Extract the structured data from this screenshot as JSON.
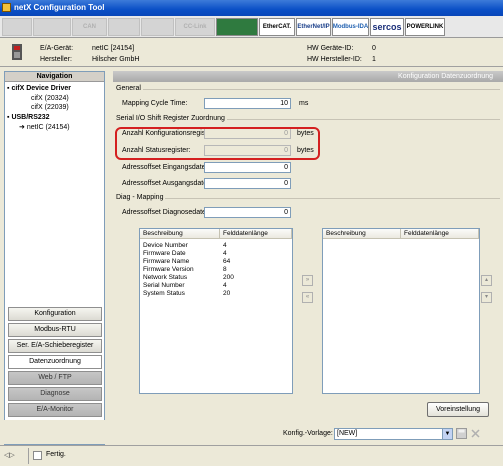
{
  "window": {
    "title": "netX Configuration Tool"
  },
  "logos": [
    {
      "name": "logo-1",
      "text": "",
      "dim": true
    },
    {
      "name": "logo-2",
      "text": "",
      "dim": true
    },
    {
      "name": "logo-canopen",
      "text": "CAN",
      "dim": true
    },
    {
      "name": "logo-4",
      "text": "",
      "dim": true
    },
    {
      "name": "logo-5",
      "text": "",
      "dim": true
    },
    {
      "name": "logo-cclink",
      "text": "CC-Link",
      "dim": true
    },
    {
      "name": "logo-compobus",
      "text": "",
      "dim": false
    },
    {
      "name": "logo-ethercat",
      "text": "EtherCAT.",
      "dim": false
    },
    {
      "name": "logo-ethernetip",
      "text": "EtherNet/IP",
      "dim": false
    },
    {
      "name": "logo-modbus-ida",
      "text": "Modbus-IDA",
      "dim": false
    },
    {
      "name": "logo-sercos",
      "text": "sercos",
      "dim": false
    },
    {
      "name": "logo-powerlink",
      "text": "POWERLINK",
      "dim": false
    }
  ],
  "header": {
    "device_label": "E/A-Gerät:",
    "device_value": "netIC [24154]",
    "vendor_label": "Hersteller:",
    "vendor_value": "Hilscher GmbH",
    "device_id_label": "HW Geräte-ID:",
    "device_id_value": "0",
    "vendor_id_label": "HW Hersteller-ID:",
    "vendor_id_value": "1"
  },
  "navigation": {
    "title": "Navigation",
    "tree": [
      {
        "label": "cifX Device Driver",
        "bold": true
      },
      {
        "label": "cifX (20324)",
        "bold": false
      },
      {
        "label": "cifX (22039)",
        "bold": false
      },
      {
        "label": "USB/RS232",
        "bold": true
      },
      {
        "label": "netIC (24154)",
        "bold": false
      }
    ],
    "buttons": [
      {
        "label": "Konfiguration"
      },
      {
        "label": "Modbus-RTU"
      },
      {
        "label": "Ser. E/A-Schieberegister"
      },
      {
        "label": "Datenzuordnung"
      },
      {
        "label": "Web / FTP"
      },
      {
        "label": "Diagnose"
      },
      {
        "label": "E/A-Monitor"
      }
    ]
  },
  "panel": {
    "title": "Konfiguration Datenzuordnung",
    "general_group": "General",
    "cycle_label": "Mapping Cycle Time:",
    "cycle_value": "10",
    "cycle_unit": "ms",
    "serial_group": "Serial I/O Shift Register Zuordnung",
    "config_reg_label": "Anzahl Konfigurationsregister:",
    "config_reg_value": "0",
    "config_reg_unit": "bytes",
    "status_reg_label": "Anzahl Statusregister:",
    "status_reg_value": "0",
    "status_reg_unit": "bytes",
    "input_offset_label": "Adressoffset Eingangsdaten:",
    "input_offset_value": "0",
    "output_offset_label": "Adressoffset Ausgangsdaten:",
    "output_offset_value": "0",
    "diag_group": "Diag - Mapping",
    "diag_offset_label": "Adressoffset Diagnosedaten:",
    "diag_offset_value": "0",
    "left_table": {
      "headers": [
        "Beschreibung",
        "Felddatenlänge"
      ],
      "rows": [
        [
          "Device Number",
          "4"
        ],
        [
          "Firmware Date",
          "4"
        ],
        [
          "Firmware Name",
          "64"
        ],
        [
          "Firmware Version",
          "8"
        ],
        [
          "Network Status",
          "200"
        ],
        [
          "Serial Number",
          "4"
        ],
        [
          "System Status",
          "20"
        ]
      ]
    },
    "right_table": {
      "headers": [
        "Beschreibung",
        "Felddatenlänge"
      ],
      "rows": []
    },
    "move_right": "»",
    "move_left": "«",
    "scroll_up": "▴",
    "scroll_down": "▾",
    "default_button": "Voreinstellung"
  },
  "bottom": {
    "template_label": "Konfig.-Vorlage:",
    "template_value": "[NEW]"
  },
  "status": {
    "text": "Fertig."
  }
}
